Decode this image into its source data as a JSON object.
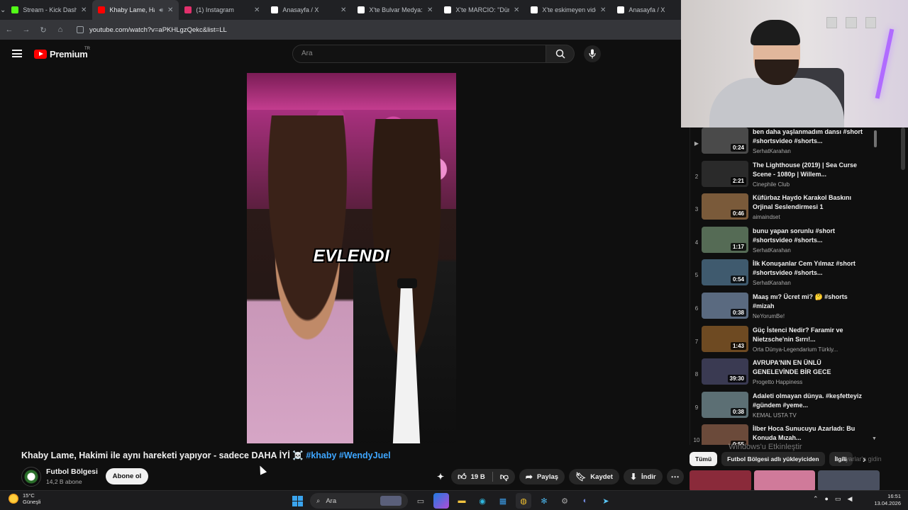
{
  "browser": {
    "tabs": [
      {
        "title": "Stream - Kick Dashb",
        "favicon_color": "#53fc18",
        "active": false
      },
      {
        "title": "Khaby Lame, Haki",
        "favicon_color": "#ff0000",
        "active": true
      },
      {
        "title": "(1) Instagram",
        "favicon_color": "#e1306c",
        "active": false
      },
      {
        "title": "Anasayfa / X",
        "favicon_color": "#ffffff",
        "active": false
      },
      {
        "title": "X'te Bulvar Medya: \"",
        "favicon_color": "#ffffff",
        "active": false
      },
      {
        "title": "X'te MARCIO: \"Dünya",
        "favicon_color": "#ffffff",
        "active": false
      },
      {
        "title": "X'te eskimeyen video",
        "favicon_color": "#ffffff",
        "active": false
      },
      {
        "title": "Anasayfa / X",
        "favicon_color": "#ffffff",
        "active": false
      }
    ],
    "url": "youtube.com/watch?v=aPKHLgzQekc&list=LL"
  },
  "youtube": {
    "logo_text": "Premium",
    "region": "TR",
    "search_placeholder": "Ara"
  },
  "video": {
    "overlay_caption": "EVLENDI",
    "title": "Khaby Lame, Hakimi ile aynı hareketi yapıyor - sadece DAHA İYİ ☠️",
    "hashtags": "#khaby #WendyJuel"
  },
  "channel": {
    "name": "Futbol Bölgesi",
    "subscribers": "14,2 B abone",
    "subscribe_label": "Abone ol"
  },
  "actions": {
    "likes": "19 B",
    "share": "Paylaş",
    "save": "Kaydet",
    "download": "İndir"
  },
  "playlist": [
    {
      "index": "▶",
      "title": "ben daha yaşlanmadım dansı #short #shortsvideo #shorts...",
      "channel": "SerhatKarahan",
      "duration": "0:24",
      "thumb": "#4a4a4a"
    },
    {
      "index": "2",
      "title": "The Lighthouse (2019) | Sea Curse Scene - 1080p | Willem...",
      "channel": "Cinephile Club",
      "duration": "2:21",
      "thumb": "#2a2a2a"
    },
    {
      "index": "3",
      "title": "Küfürbaz Haydo Karakol Baskını Orjinal Seslendirmesi 1",
      "channel": "aimaindset",
      "duration": "0:46",
      "thumb": "#7a5a3a"
    },
    {
      "index": "4",
      "title": "bunu yapan sorunlu #short #shortsvideo #shorts...",
      "channel": "SerhatKarahan",
      "duration": "1:17",
      "thumb": "#556b55"
    },
    {
      "index": "5",
      "title": "İlk Konuşanlar Cem Yılmaz #short #shortsvideo #shorts...",
      "channel": "SerhatKarahan",
      "duration": "0:54",
      "thumb": "#3f5a6e"
    },
    {
      "index": "6",
      "title": "Maaş mı? Ücret mi? 🤔 #shorts #mizah",
      "channel": "NeYorumBe!",
      "duration": "0:38",
      "thumb": "#5a6a80"
    },
    {
      "index": "7",
      "title": "Güç İstenci Nedir? Faramir ve Nietzsche'nin Sırrı!...",
      "channel": "Orta Dünya-Legendarium Türkiy...",
      "duration": "1:43",
      "thumb": "#6e4a22"
    },
    {
      "index": "8",
      "title": "AVRUPA'NIN EN ÜNLÜ GENELEVİNDE BİR GECE",
      "channel": "Progetto Happiness",
      "duration": "39:30",
      "thumb": "#3a3a52"
    },
    {
      "index": "9",
      "title": "Adaleti olmayan dünya. #keşfetteyiz #gündem #yeme...",
      "channel": "KEMAL USTA TV",
      "duration": "0:38",
      "thumb": "#5c6f74"
    },
    {
      "index": "10",
      "title": "İlber Hoca Sunucuyu Azarladı: Bu Konuda Mızah...",
      "channel": "",
      "duration": "0:55",
      "thumb": "#6b4a3a"
    }
  ],
  "chips": [
    "Tümü",
    "Futbol Bölgesi adlı yükleyiciden",
    "İlgili"
  ],
  "watermark": {
    "line1": "Windows'u Etkinleştir",
    "line2": "Ayarlar'a gidin"
  },
  "taskbar": {
    "temperature": "15°C",
    "weather": "Güneşli",
    "search_placeholder": "Ara",
    "time": "16:51",
    "date": "13.04.2026"
  }
}
